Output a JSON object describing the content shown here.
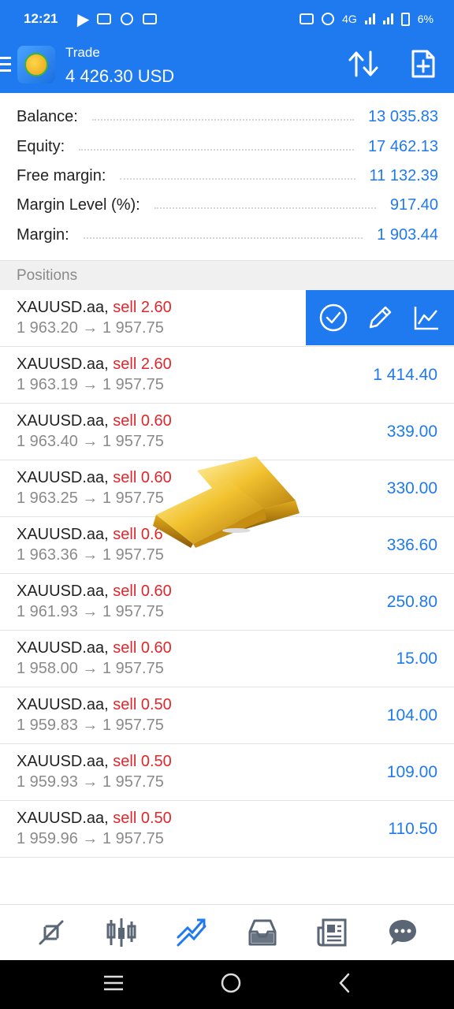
{
  "status_bar": {
    "time": "12:21",
    "network": "4G",
    "battery": "6%"
  },
  "app_bar": {
    "title": "Trade",
    "value": "4 426.30 USD",
    "icons": {
      "menu": "menu-icon",
      "logo": "app-logo",
      "sort": "sort-icon",
      "new_order": "new-order-icon"
    }
  },
  "account": {
    "rows": [
      {
        "label": "Balance:",
        "value": "13 035.83"
      },
      {
        "label": "Equity:",
        "value": "17 462.13"
      },
      {
        "label": "Free margin:",
        "value": "11 132.39"
      },
      {
        "label": "Margin Level (%):",
        "value": "917.40"
      },
      {
        "label": "Margin:",
        "value": "1 903.44"
      }
    ]
  },
  "positions": {
    "header": "Positions",
    "rows": [
      {
        "symbol": "XAUUSD.aa,",
        "side": "sell 2.60",
        "prices": "1 963.20 → 1 957.75",
        "profit": ""
      },
      {
        "symbol": "XAUUSD.aa,",
        "side": "sell 2.60",
        "prices": "1 963.19 → 1 957.75",
        "profit": "1 414.40"
      },
      {
        "symbol": "XAUUSD.aa,",
        "side": "sell 0.60",
        "prices": "1 963.40 → 1 957.75",
        "profit": "339.00"
      },
      {
        "symbol": "XAUUSD.aa,",
        "side": "sell 0.60",
        "prices": "1 963.25 → 1 957.75",
        "profit": "330.00"
      },
      {
        "symbol": "XAUUSD.aa,",
        "side": "sell 0.6",
        "prices": "1 963.36 → 1 957.75",
        "profit": "336.60"
      },
      {
        "symbol": "XAUUSD.aa,",
        "side": "sell 0.60",
        "prices": "1 961.93 → 1 957.75",
        "profit": "250.80"
      },
      {
        "symbol": "XAUUSD.aa,",
        "side": "sell 0.60",
        "prices": "1 958.00 → 1 957.75",
        "profit": "15.00"
      },
      {
        "symbol": "XAUUSD.aa,",
        "side": "sell 0.50",
        "prices": "1 959.83 → 1 957.75",
        "profit": "104.00"
      },
      {
        "symbol": "XAUUSD.aa,",
        "side": "sell 0.50",
        "prices": "1 959.93 → 1 957.75",
        "profit": "109.00"
      },
      {
        "symbol": "XAUUSD.aa,",
        "side": "sell 0.50",
        "prices": "1 959.96 → 1 957.75",
        "profit": "110.50"
      }
    ],
    "row_actions": [
      "check-icon",
      "edit-icon",
      "chart-icon"
    ]
  },
  "bottom_nav": {
    "items": [
      "quotes-icon",
      "chart-icon",
      "trade-icon",
      "history-icon",
      "news-icon",
      "messages-icon"
    ],
    "active_index": 2
  },
  "colors": {
    "accent": "#1f7af0",
    "sell": "#e0272b",
    "muted": "#8a8a8a"
  }
}
